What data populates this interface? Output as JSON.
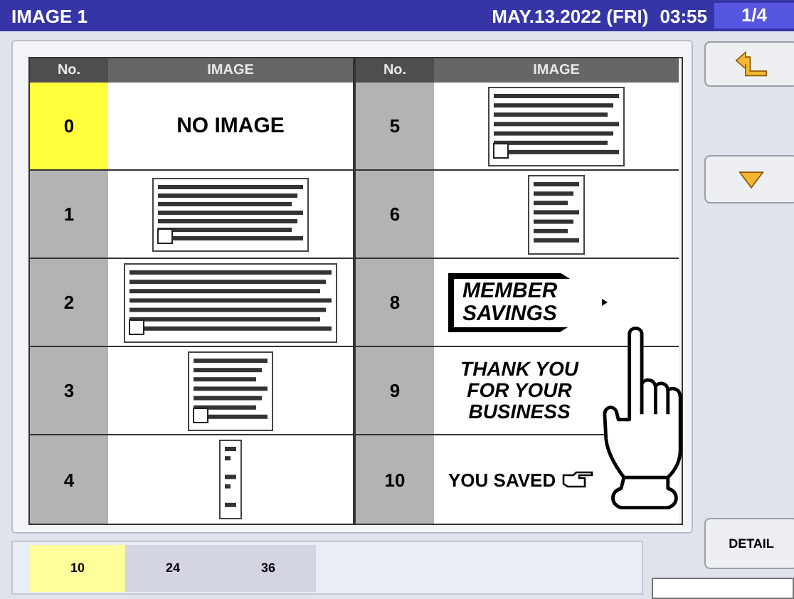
{
  "title_bar": {
    "title": "IMAGE 1",
    "date": "MAY.13.2022 (FRI)",
    "time": "03:55",
    "page": "1/4"
  },
  "tables": [
    {
      "columns": [
        "No.",
        "IMAGE"
      ],
      "rows": [
        {
          "no": "0",
          "selected": true,
          "image": {
            "kind": "text",
            "text": "NO IMAGE"
          }
        },
        {
          "no": "1",
          "selected": false
        },
        {
          "no": "2",
          "selected": false
        },
        {
          "no": "3",
          "selected": false
        },
        {
          "no": "4",
          "selected": false
        }
      ]
    },
    {
      "columns": [
        "No.",
        "IMAGE"
      ],
      "rows": [
        {
          "no": "5",
          "selected": false
        },
        {
          "no": "6",
          "selected": false
        },
        {
          "no": "8",
          "selected": false,
          "image": {
            "kind": "arrow",
            "text": "MEMBER SAVINGS"
          }
        },
        {
          "no": "9",
          "selected": false,
          "image": {
            "kind": "script",
            "text": "THANK YOU FOR YOUR BUSINESS"
          }
        },
        {
          "no": "10",
          "selected": false,
          "image": {
            "kind": "pointer",
            "text": "YOU SAVED"
          }
        }
      ]
    }
  ],
  "pager_tabs": [
    {
      "label": "10",
      "selected": true
    },
    {
      "label": "24",
      "selected": false
    },
    {
      "label": "36",
      "selected": false
    }
  ],
  "detail_button": "DETAIL"
}
